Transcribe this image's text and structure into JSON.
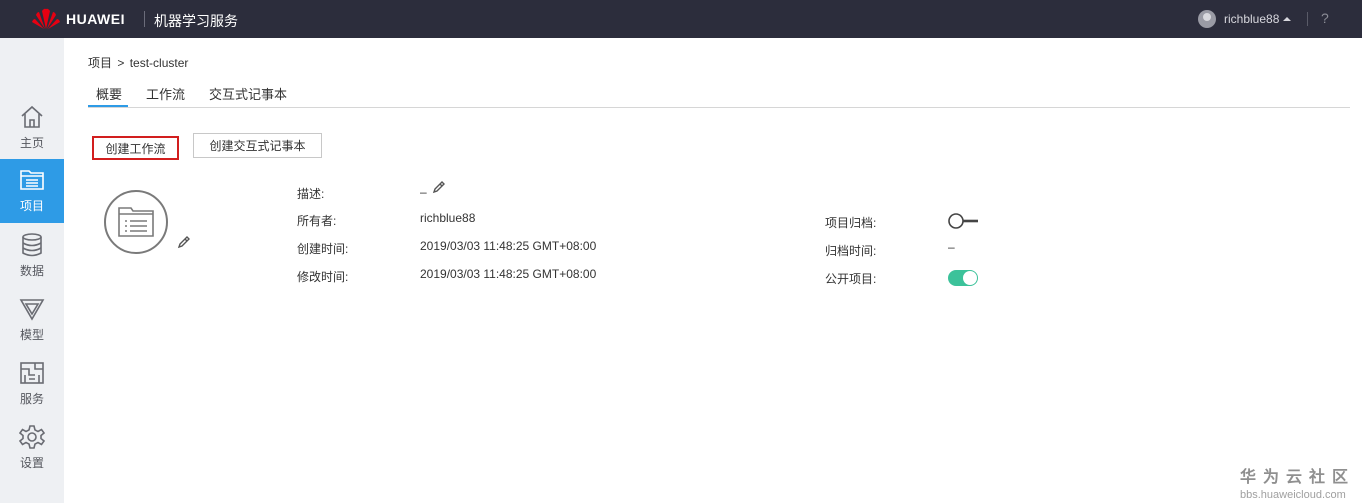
{
  "topbar": {
    "brand": "HUAWEI",
    "app_title": "机器学习服务",
    "username": "richblue88",
    "help": "?"
  },
  "sidebar": {
    "items": [
      {
        "label": "主页",
        "icon": "home-icon"
      },
      {
        "label": "项目",
        "icon": "project-icon",
        "active": true
      },
      {
        "label": "数据",
        "icon": "database-icon"
      },
      {
        "label": "模型",
        "icon": "model-icon"
      },
      {
        "label": "服务",
        "icon": "service-icon"
      },
      {
        "label": "设置",
        "icon": "settings-icon"
      }
    ]
  },
  "breadcrumb": {
    "root": "项目",
    "separator": ">",
    "current": "test-cluster"
  },
  "tabs": [
    {
      "label": "概要",
      "active": true
    },
    {
      "label": "工作流"
    },
    {
      "label": "交互式记事本"
    }
  ],
  "actions": {
    "create_workflow": "创建工作流",
    "create_notebook": "创建交互式记事本"
  },
  "details": {
    "description_label": "描述:",
    "description_value": "–",
    "owner_label": "所有者:",
    "owner_value": "richblue88",
    "created_label": "创建时间:",
    "created_value": "2019/03/03 11:48:25 GMT+08:00",
    "modified_label": "修改时间:",
    "modified_value": "2019/03/03 11:48:25 GMT+08:00",
    "archive_label": "项目归档:",
    "archive_on": false,
    "archive_time_label": "归档时间:",
    "archive_time_value": "–",
    "public_label": "公开项目:",
    "public_on": true
  },
  "watermark": {
    "title": "华为云社区",
    "url": "bbs.huaweicloud.com"
  },
  "colors": {
    "topbar": "#2c2d3c",
    "accent": "#2e9be6",
    "toggle_on": "#3cc29a",
    "highlight": "#d21e1e"
  }
}
